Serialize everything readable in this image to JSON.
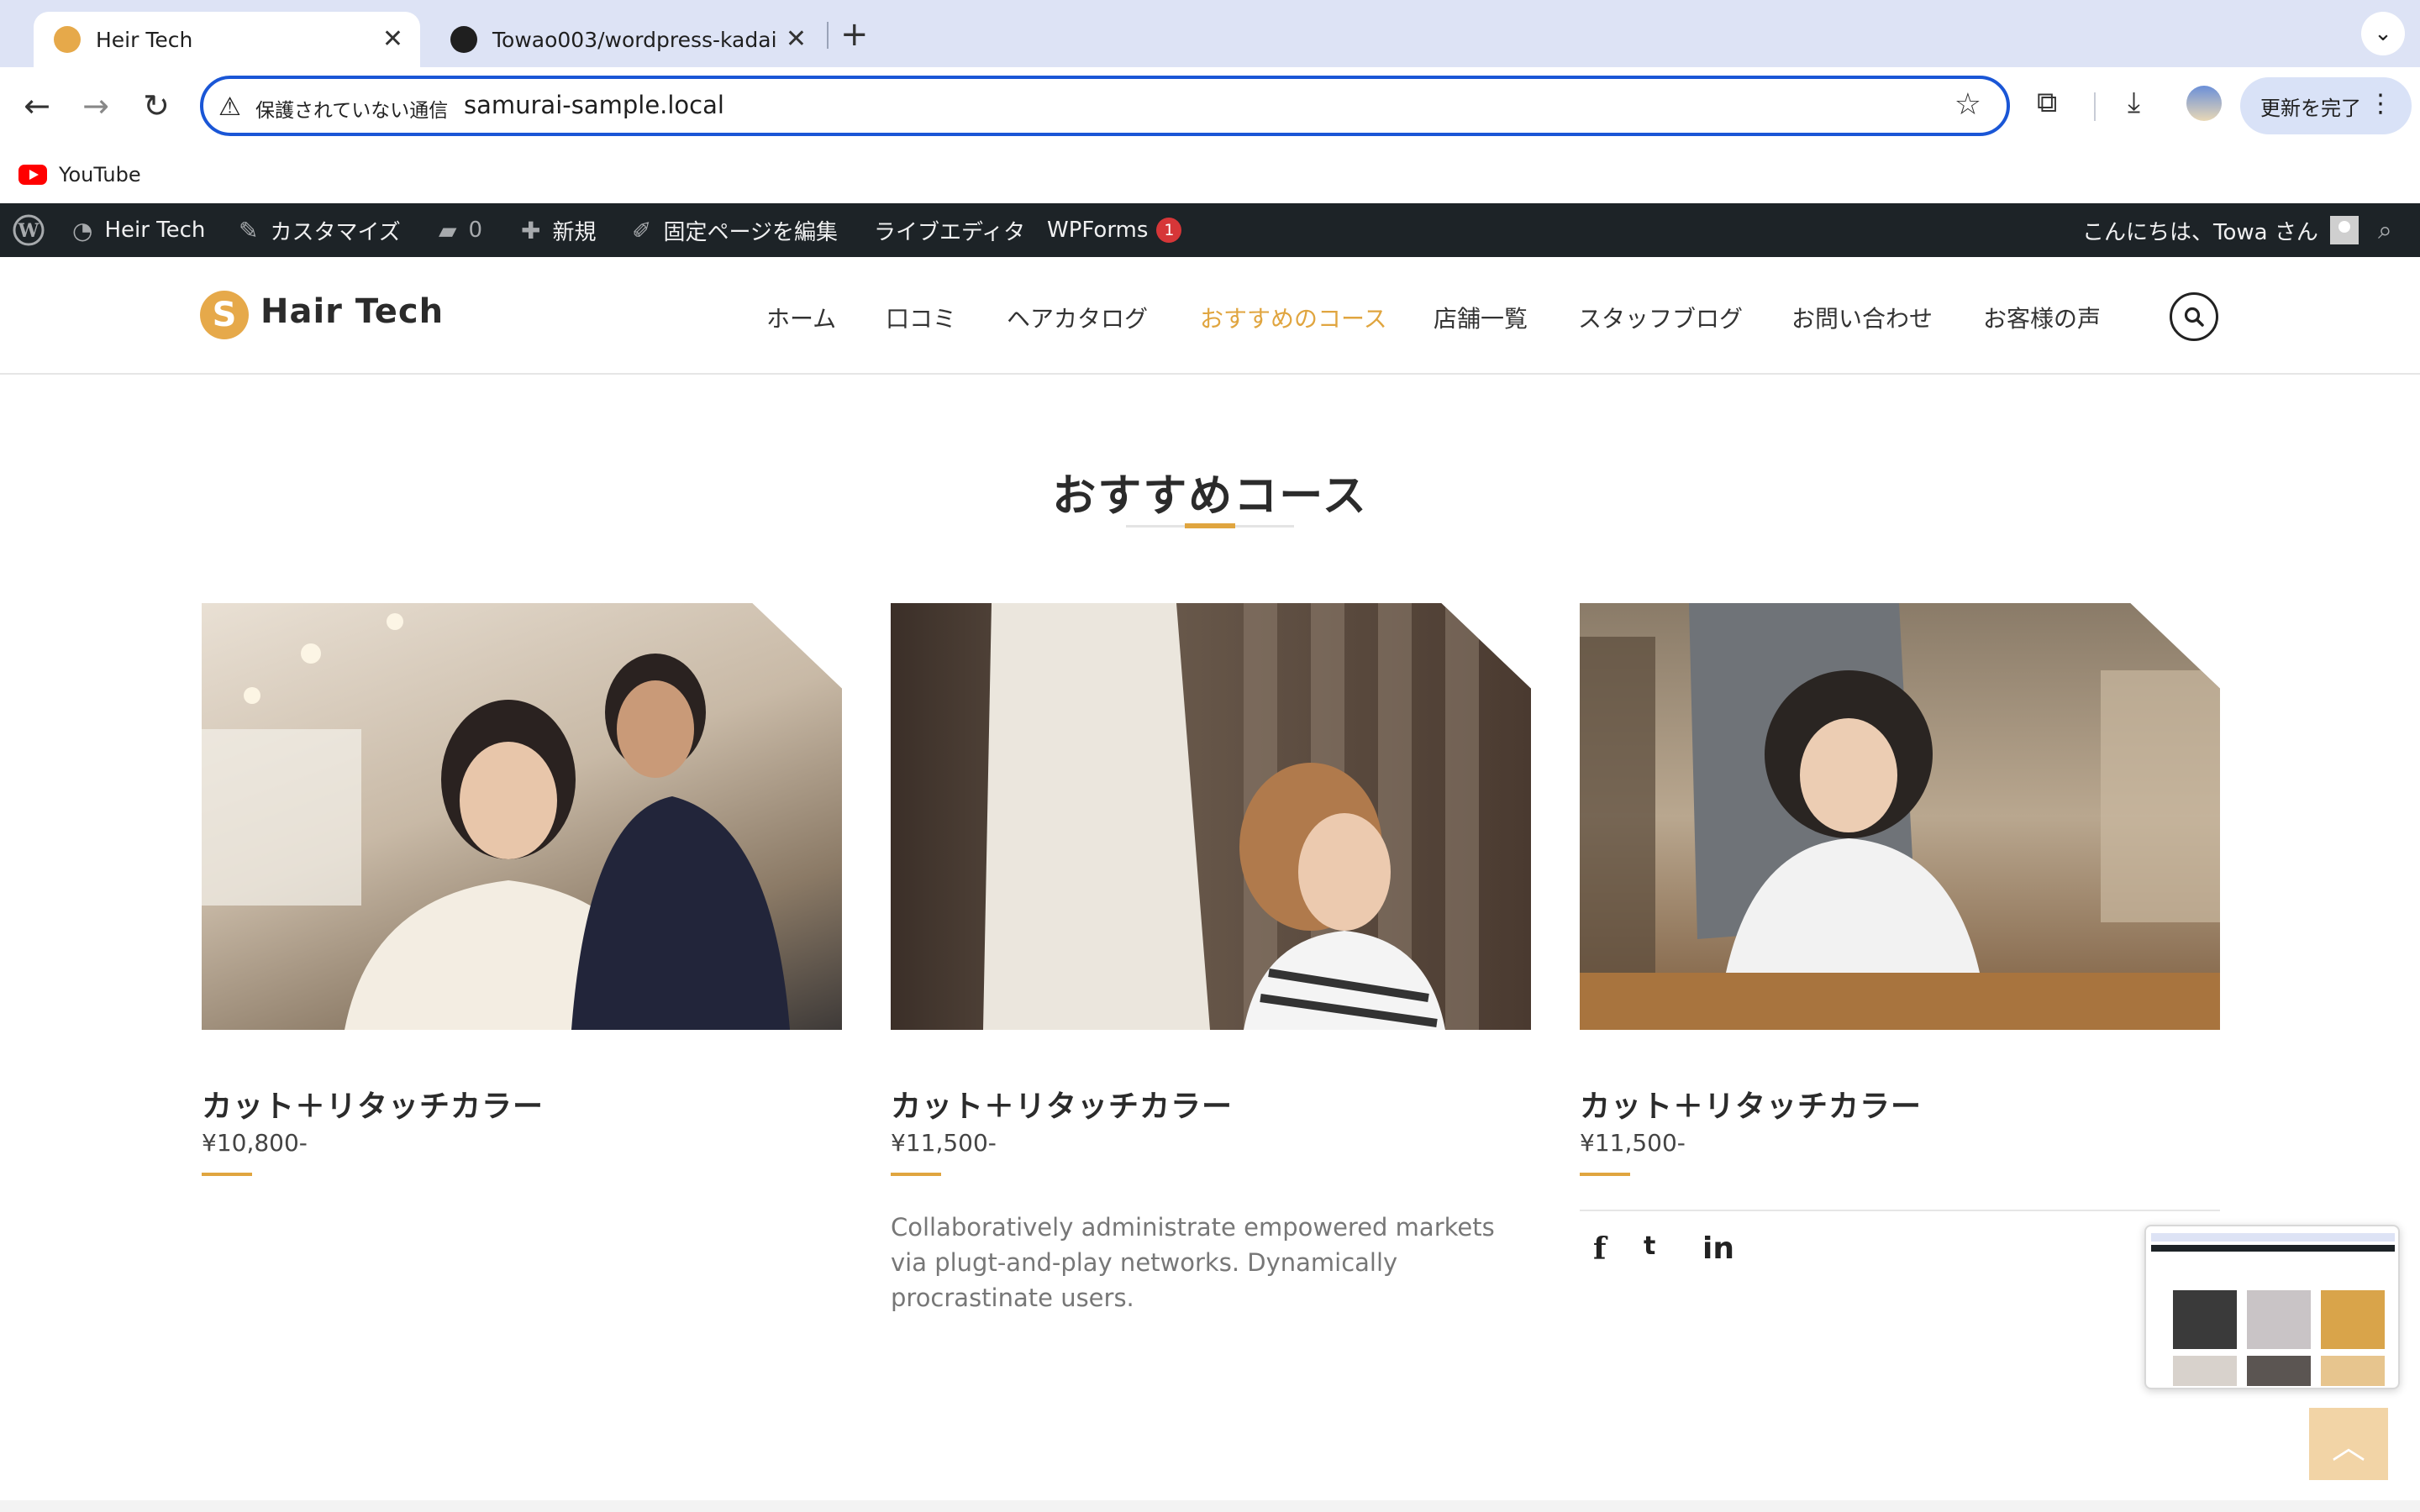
{
  "browser": {
    "tabs": [
      {
        "title": "Heir Tech",
        "active": true
      },
      {
        "title": "Towao003/wordpress-kadai",
        "active": false
      }
    ],
    "new_tab": "+",
    "tab_menu": "⌄",
    "omnibox": {
      "security_label": "保護されていない通信",
      "url": "samurai-sample.local"
    },
    "update_button": "更新を完了",
    "bookmarks": [
      {
        "label": "YouTube"
      }
    ]
  },
  "admin_bar": {
    "site_name": "Heir Tech",
    "customize": "カスタマイズ",
    "comments_count": "0",
    "new": "新規",
    "edit_page": "固定ページを編集",
    "live_editor": "ライブエディタ",
    "wpforms": "WPForms",
    "wpforms_badge": "1",
    "greeting": "こんにちは、Towa さん"
  },
  "site": {
    "logo_mark": "S",
    "logo_text": "Hair Tech",
    "nav": [
      {
        "label": "ホーム",
        "current": false
      },
      {
        "label": "口コミ",
        "current": false
      },
      {
        "label": "ヘアカタログ",
        "current": false
      },
      {
        "label": "おすすめのコース",
        "current": true
      },
      {
        "label": "店舗一覧",
        "current": false
      },
      {
        "label": "スタッフブログ",
        "current": false
      },
      {
        "label": "お問い合わせ",
        "current": false
      },
      {
        "label": "お客様の声",
        "current": false
      }
    ]
  },
  "page": {
    "title": "おすすめコース",
    "cards": [
      {
        "title": "カット＋リタッチカラー",
        "price": "¥10,800-"
      },
      {
        "title": "カット＋リタッチカラー",
        "price": "¥11,500-",
        "description": "Collaboratively administrate empowered markets via plugt-and-play networks. Dynamically procrastinate users."
      },
      {
        "title": "カット＋リタッチカラー",
        "price": "¥11,500-",
        "social": [
          "f",
          "t",
          "in"
        ]
      }
    ]
  },
  "colors": {
    "accent": "#e0a53f",
    "admin_bar": "#1d2327",
    "omnibox_border": "#1a56d6",
    "tab_bar": "#dde3f5"
  },
  "icons": {
    "back": "←",
    "forward": "→",
    "reload": "↻",
    "warning": "⚠",
    "star": "☆",
    "extensions": "⧉",
    "download": "⤓",
    "kebab": "⋮",
    "search": "⌕",
    "to_top": "︿"
  }
}
